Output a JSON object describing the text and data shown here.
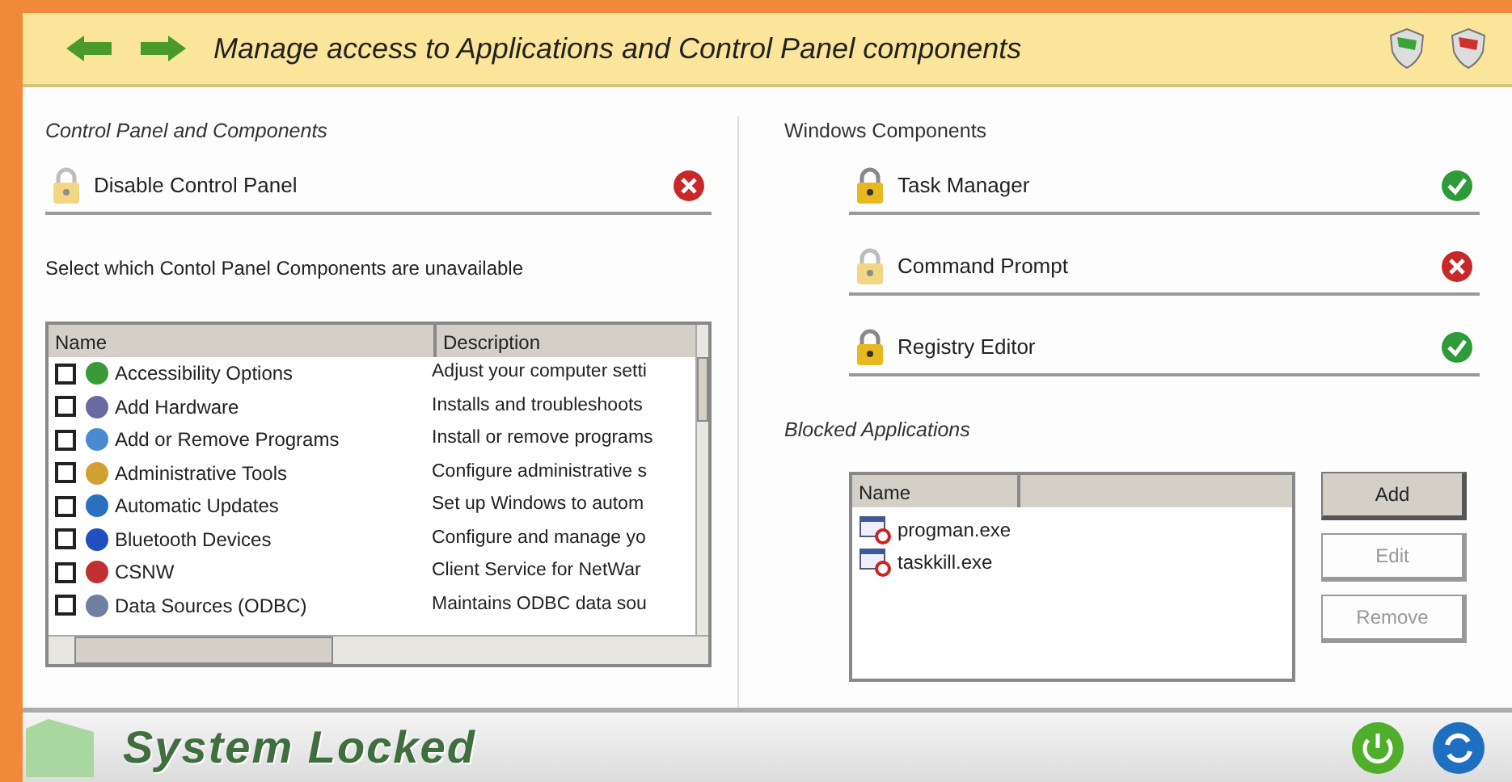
{
  "header": {
    "title": "Manage access to Applications and Control Panel components"
  },
  "control_panel": {
    "heading": "Control Panel and Components",
    "item": {
      "label": "Disable Control Panel",
      "allowed": false
    },
    "prompt": "Select which Contol Panel Components are unavailable",
    "table": {
      "columns": [
        "Name",
        "Description"
      ],
      "rows": [
        {
          "name": "Accessibility Options",
          "description": "Adjust your computer setti",
          "checked": false
        },
        {
          "name": "Add Hardware",
          "description": "Installs and troubleshoots",
          "checked": false
        },
        {
          "name": "Add or Remove Programs",
          "description": "Install or remove programs",
          "checked": false
        },
        {
          "name": "Administrative Tools",
          "description": "Configure administrative s",
          "checked": false
        },
        {
          "name": "Automatic Updates",
          "description": "Set up Windows to autom",
          "checked": false
        },
        {
          "name": "Bluetooth Devices",
          "description": "Configure and manage yo",
          "checked": false
        },
        {
          "name": "CSNW",
          "description": "Client Service for NetWar",
          "checked": false
        },
        {
          "name": "Data Sources (ODBC)",
          "description": "Maintains ODBC data sou",
          "checked": false
        }
      ]
    }
  },
  "windows_components": {
    "heading": "Windows Components",
    "items": [
      {
        "label": "Task Manager",
        "allowed": true
      },
      {
        "label": "Command Prompt",
        "allowed": false
      },
      {
        "label": "Registry Editor",
        "allowed": true
      }
    ]
  },
  "blocked_applications": {
    "heading": "Blocked Applications",
    "columns": [
      "Name"
    ],
    "rows": [
      "progman.exe",
      "taskkill.exe"
    ],
    "buttons": [
      {
        "label": "Add",
        "disabled": false
      },
      {
        "label": "Edit",
        "disabled": true
      },
      {
        "label": "Remove",
        "disabled": true
      }
    ]
  },
  "status_bar": {
    "text": "System Locked"
  }
}
